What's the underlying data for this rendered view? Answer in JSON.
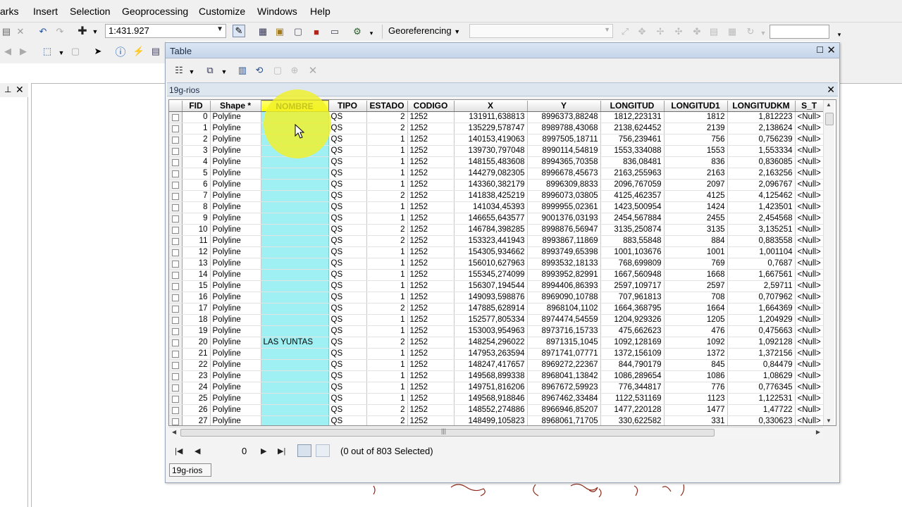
{
  "menu": [
    "arks",
    "Insert",
    "Selection",
    "Geoprocessing",
    "Customize",
    "Windows",
    "Help"
  ],
  "toolbar": {
    "scale": "1:431.927",
    "georeferencing_label": "Georeferencing",
    "georef_layer_value": "",
    "right_input_value": ""
  },
  "table_window": {
    "title": "Table",
    "tab_title": "19g-rios",
    "bottom_tab_label": "19g-rios",
    "record_number": "0",
    "selection_status": "(0 out of 803 Selected)"
  },
  "columns": [
    "FID",
    "Shape *",
    "NOMBRE",
    "TIPO",
    "ESTADO",
    "CODIGO",
    "X",
    "Y",
    "LONGITUD",
    "LONGITUD1",
    "LONGITUDKM",
    "S_T"
  ],
  "rows": [
    [
      "0",
      "Polyline",
      "",
      "QS",
      "2",
      "1252",
      "131911,638813",
      "8996373,88248",
      "1812,223131",
      "1812",
      "1,812223",
      "<Null>"
    ],
    [
      "1",
      "Polyline",
      "",
      "QS",
      "2",
      "1252",
      "135229,578747",
      "8989788,43068",
      "2138,624452",
      "2139",
      "2,138624",
      "<Null>"
    ],
    [
      "2",
      "Polyline",
      "",
      "QS",
      "1",
      "1252",
      "140153,419063",
      "8997505,18711",
      "756,239461",
      "756",
      "0,756239",
      "<Null>"
    ],
    [
      "3",
      "Polyline",
      "",
      "QS",
      "1",
      "1252",
      "139730,797048",
      "8990114,54819",
      "1553,334088",
      "1553",
      "1,553334",
      "<Null>"
    ],
    [
      "4",
      "Polyline",
      "",
      "QS",
      "1",
      "1252",
      "148155,483608",
      "8994365,70358",
      "836,08481",
      "836",
      "0,836085",
      "<Null>"
    ],
    [
      "5",
      "Polyline",
      "",
      "QS",
      "1",
      "1252",
      "144279,082305",
      "8996678,45673",
      "2163,255963",
      "2163",
      "2,163256",
      "<Null>"
    ],
    [
      "6",
      "Polyline",
      "",
      "QS",
      "1",
      "1252",
      "143360,382179",
      "8996309,8833",
      "2096,767059",
      "2097",
      "2,096767",
      "<Null>"
    ],
    [
      "7",
      "Polyline",
      "",
      "QS",
      "2",
      "1252",
      "141838,425219",
      "8996073,03805",
      "4125,462357",
      "4125",
      "4,125462",
      "<Null>"
    ],
    [
      "8",
      "Polyline",
      "",
      "QS",
      "1",
      "1252",
      "141034,45393",
      "8999955,02361",
      "1423,500954",
      "1424",
      "1,423501",
      "<Null>"
    ],
    [
      "9",
      "Polyline",
      "",
      "QS",
      "1",
      "1252",
      "146655,643577",
      "9001376,03193",
      "2454,567884",
      "2455",
      "2,454568",
      "<Null>"
    ],
    [
      "10",
      "Polyline",
      "",
      "QS",
      "2",
      "1252",
      "146784,398285",
      "8998876,56947",
      "3135,250874",
      "3135",
      "3,135251",
      "<Null>"
    ],
    [
      "11",
      "Polyline",
      "",
      "QS",
      "2",
      "1252",
      "153323,441943",
      "8993867,11869",
      "883,55848",
      "884",
      "0,883558",
      "<Null>"
    ],
    [
      "12",
      "Polyline",
      "",
      "QS",
      "1",
      "1252",
      "154305,934662",
      "8993749,65398",
      "1001,103676",
      "1001",
      "1,001104",
      "<Null>"
    ],
    [
      "13",
      "Polyline",
      "",
      "QS",
      "1",
      "1252",
      "156010,627963",
      "8993532,18133",
      "768,699809",
      "769",
      "0,7687",
      "<Null>"
    ],
    [
      "14",
      "Polyline",
      "",
      "QS",
      "1",
      "1252",
      "155345,274099",
      "8993952,82991",
      "1667,560948",
      "1668",
      "1,667561",
      "<Null>"
    ],
    [
      "15",
      "Polyline",
      "",
      "QS",
      "1",
      "1252",
      "156307,194544",
      "8994406,86393",
      "2597,109717",
      "2597",
      "2,59711",
      "<Null>"
    ],
    [
      "16",
      "Polyline",
      "",
      "QS",
      "1",
      "1252",
      "149093,598876",
      "8969090,10788",
      "707,961813",
      "708",
      "0,707962",
      "<Null>"
    ],
    [
      "17",
      "Polyline",
      "",
      "QS",
      "2",
      "1252",
      "147885,628914",
      "8968104,1102",
      "1664,368795",
      "1664",
      "1,664369",
      "<Null>"
    ],
    [
      "18",
      "Polyline",
      "",
      "QS",
      "1",
      "1252",
      "152577,805334",
      "8974474,54559",
      "1204,929326",
      "1205",
      "1,204929",
      "<Null>"
    ],
    [
      "19",
      "Polyline",
      "",
      "QS",
      "1",
      "1252",
      "153003,954963",
      "8973716,15733",
      "475,662623",
      "476",
      "0,475663",
      "<Null>"
    ],
    [
      "20",
      "Polyline",
      "LAS YUNTAS",
      "QS",
      "2",
      "1252",
      "148254,296022",
      "8971315,1045",
      "1092,128169",
      "1092",
      "1,092128",
      "<Null>"
    ],
    [
      "21",
      "Polyline",
      "",
      "QS",
      "1",
      "1252",
      "147953,263594",
      "8971741,07771",
      "1372,156109",
      "1372",
      "1,372156",
      "<Null>"
    ],
    [
      "22",
      "Polyline",
      "",
      "QS",
      "1",
      "1252",
      "148247,417657",
      "8969272,22367",
      "844,790179",
      "845",
      "0,84479",
      "<Null>"
    ],
    [
      "23",
      "Polyline",
      "",
      "QS",
      "1",
      "1252",
      "149568,899338",
      "8968041,13842",
      "1086,289654",
      "1086",
      "1,08629",
      "<Null>"
    ],
    [
      "24",
      "Polyline",
      "",
      "QS",
      "1",
      "1252",
      "149751,816206",
      "8967672,59923",
      "776,344817",
      "776",
      "0,776345",
      "<Null>"
    ],
    [
      "25",
      "Polyline",
      "",
      "QS",
      "1",
      "1252",
      "149568,918846",
      "8967462,33484",
      "1122,531169",
      "1123",
      "1,122531",
      "<Null>"
    ],
    [
      "26",
      "Polyline",
      "",
      "QS",
      "2",
      "1252",
      "148552,274886",
      "8966946,85207",
      "1477,220128",
      "1477",
      "1,47722",
      "<Null>"
    ],
    [
      "27",
      "Polyline",
      "",
      "QS",
      "2",
      "1252",
      "148499,105823",
      "8968061,71705",
      "330,622582",
      "331",
      "0,330623",
      "<Null>"
    ]
  ],
  "selected_column": "NOMBRE",
  "colors": {
    "selected_column_header": "#ffff00",
    "selected_column_cells": "#9ff0f2",
    "cursor_halo": "#f0f028"
  }
}
